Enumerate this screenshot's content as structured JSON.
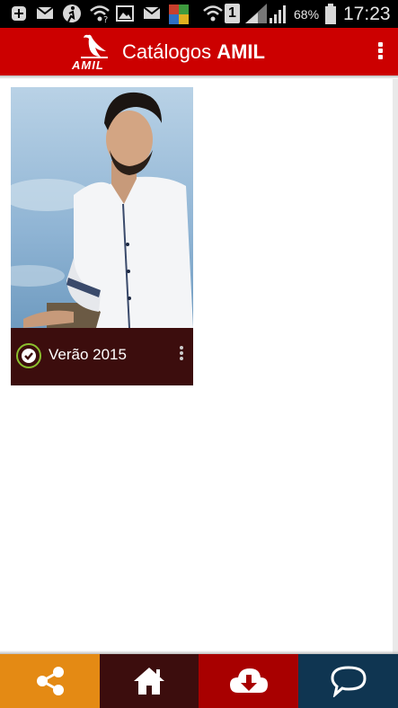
{
  "status_bar": {
    "battery_percent": "68%",
    "time": "17:23",
    "sim_slot": "1",
    "icons": [
      "add-icon",
      "mail-icon",
      "runner-icon",
      "wifi-question-icon",
      "image-icon",
      "mail-icon",
      "app-icon",
      "wifi-icon",
      "sim-icon",
      "signal-icon",
      "signal-icon",
      "battery-icon"
    ]
  },
  "app_bar": {
    "logo_text": "AMIL",
    "title_prefix": "Catálogos",
    "title_brand": "AMIL",
    "colors": {
      "background": "#cc0000"
    }
  },
  "catalogs": [
    {
      "title": "Verão 2015",
      "downloaded": true
    }
  ],
  "bottom_nav": {
    "items": [
      {
        "icon": "share-icon",
        "color": "#e48a14"
      },
      {
        "icon": "home-icon",
        "color": "#3c0d0d"
      },
      {
        "icon": "cloud-download-icon",
        "color": "#a80000"
      },
      {
        "icon": "chat-bubble-icon",
        "color": "#0f3551"
      }
    ]
  }
}
